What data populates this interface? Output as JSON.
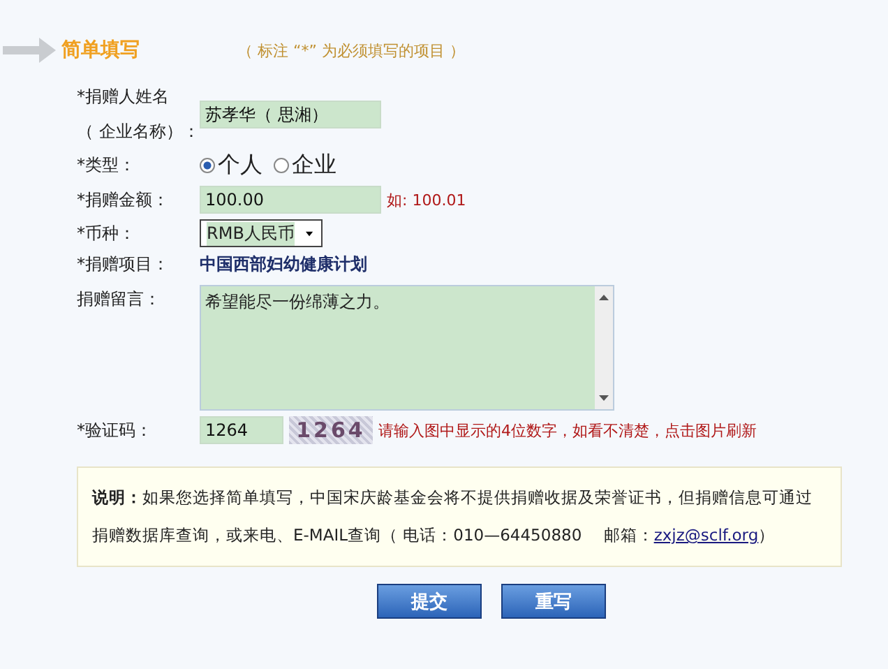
{
  "header": {
    "title": "简单填写",
    "note": "（ 标注 “*” 为必须填写的项目 ）"
  },
  "form": {
    "name": {
      "label_line1": "*捐赠人姓名",
      "label_line2": "（ 企业名称）：",
      "value": "苏孝华（ 思湘）"
    },
    "type": {
      "label": "*类型：",
      "options": [
        {
          "label": "个人",
          "selected": true
        },
        {
          "label": "企业",
          "selected": false
        }
      ]
    },
    "amount": {
      "label": "*捐赠金额：",
      "value": "100.00",
      "hint": "如: 100.01"
    },
    "currency": {
      "label": "*币种：",
      "value": "RMB人民币"
    },
    "project": {
      "label": "*捐赠项目：",
      "value": "中国西部妇幼健康计划"
    },
    "message": {
      "label": "捐赠留言：",
      "value": "希望能尽一份绵薄之力。"
    },
    "captcha": {
      "label": "*验证码：",
      "value": "1264",
      "image_text": "1264",
      "hint": "请输入图中显示的4位数字，如看不清楚，点击图片刷新"
    }
  },
  "note": {
    "text": "**说明：**如果您选择简单填写，中国宋庆龄基金会将不提供捐赠收据及荣誉证书，但捐赠信息可通过捐赠数据库查询，或来电、E-MAIL查询（ 电话：010—64450880　 邮箱：",
    "email": "zxjz@sclf.org",
    "tail": "）"
  },
  "buttons": [
    "提交",
    "重写"
  ]
}
